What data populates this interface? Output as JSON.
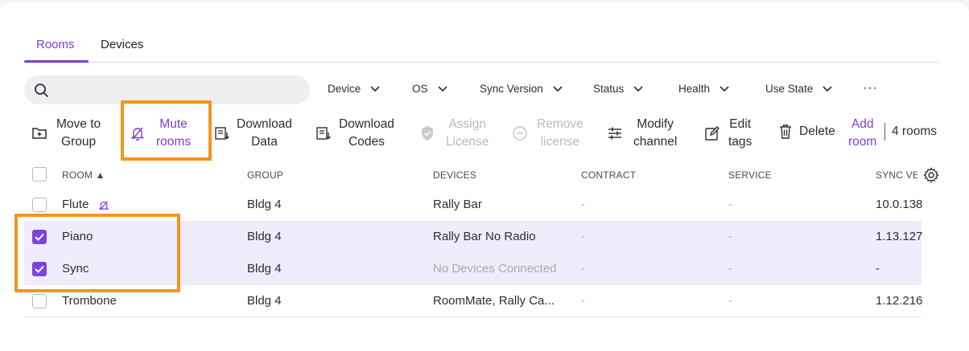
{
  "tabs": [
    "Rooms",
    "Devices"
  ],
  "search": {
    "placeholder": "",
    "value": ""
  },
  "filters": [
    "Device",
    "OS",
    "Sync Version",
    "Status",
    "Health",
    "Use State"
  ],
  "more_label": "···",
  "toolbar": {
    "move_to_group": [
      "Move to",
      "Group"
    ],
    "mute_rooms": [
      "Mute",
      "rooms"
    ],
    "download_data": [
      "Download",
      "Data"
    ],
    "download_codes": [
      "Download",
      "Codes"
    ],
    "assign_license": [
      "Assign",
      "License"
    ],
    "remove_license": [
      "Remove",
      "license"
    ],
    "modify_channel": [
      "Modify",
      "channel"
    ],
    "edit_tags": [
      "Edit",
      "tags"
    ],
    "delete": "Delete",
    "add_room": [
      "Add",
      "room"
    ],
    "room_count": "4 rooms"
  },
  "table": {
    "headers": [
      "ROOM ▲",
      "GROUP",
      "DEVICES",
      "CONTRACT",
      "SERVICE",
      "SYNC VERSION"
    ],
    "rows": [
      {
        "room": "Flute",
        "muted_icon": "bell-off-icon",
        "group": "Bldg 4",
        "devices": "Rally Bar",
        "contract": "-",
        "service": "-",
        "sync": "10.0.138",
        "checked": false
      },
      {
        "room": "Piano",
        "group": "Bldg 4",
        "devices": "Rally Bar No Radio",
        "contract": "-",
        "service": "-",
        "sync": "1.13.127",
        "checked": true
      },
      {
        "room": "Sync",
        "group": "Bldg 4",
        "devices": "No Devices Connected",
        "contract": "-",
        "service": "-",
        "sync": "-",
        "checked": true
      },
      {
        "room": "Trombone",
        "group": "Bldg 4",
        "devices": "RoomMate, Rally Ca...",
        "contract": "-",
        "service": "-",
        "sync": "1.12.216",
        "checked": false
      }
    ]
  },
  "colors": {
    "accent": "#7a3fd4",
    "highlight": "#f7941d",
    "selected_row": "#f1ecfb"
  }
}
